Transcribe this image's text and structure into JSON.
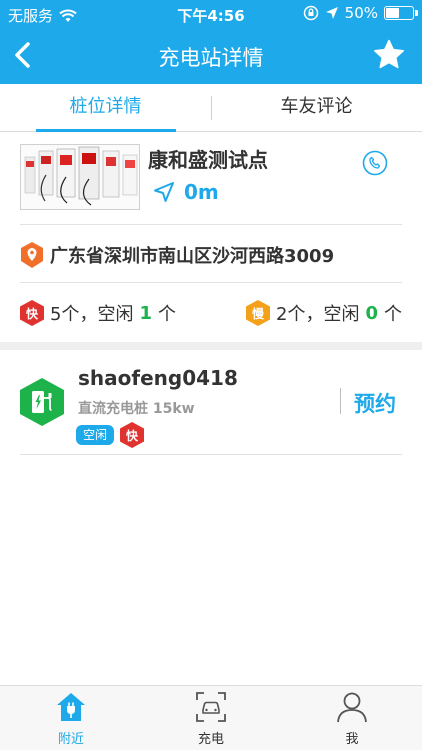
{
  "status": {
    "carrier": "无服务",
    "time": "下午4:56",
    "battery": "50%",
    "battery_level": 0.5
  },
  "nav": {
    "title": "充电站详情",
    "back_icon": "chevron-left-icon",
    "favorite_icon": "star-icon"
  },
  "tabs": [
    {
      "label": "桩位详情",
      "active": true
    },
    {
      "label": "车友评论",
      "active": false
    }
  ],
  "station": {
    "name": "康和盛测试点",
    "distance": "0m",
    "address": "广东省深圳市南山区沙河西路3009",
    "fast": {
      "badge": "快",
      "count_text": "5个，空闲",
      "free": "1",
      "unit": "个"
    },
    "slow": {
      "badge": "慢",
      "count_text": "2个，空闲",
      "free": "0",
      "unit": "个"
    }
  },
  "pile": {
    "name": "shaofeng0418",
    "desc": "直流充电桩 15kw",
    "status_tag": "空闲",
    "speed_tag": "快",
    "reserve_label": "预约"
  },
  "tabbar": [
    {
      "label": "附近",
      "icon": "home-plug-icon",
      "active": true
    },
    {
      "label": "充电",
      "icon": "car-scan-icon",
      "active": false
    },
    {
      "label": "我",
      "icon": "user-icon",
      "active": false
    }
  ],
  "colors": {
    "primary": "#1da9ea",
    "green": "#1bb34a",
    "fast_red": "#e0322f",
    "slow_orange": "#f4a019"
  }
}
